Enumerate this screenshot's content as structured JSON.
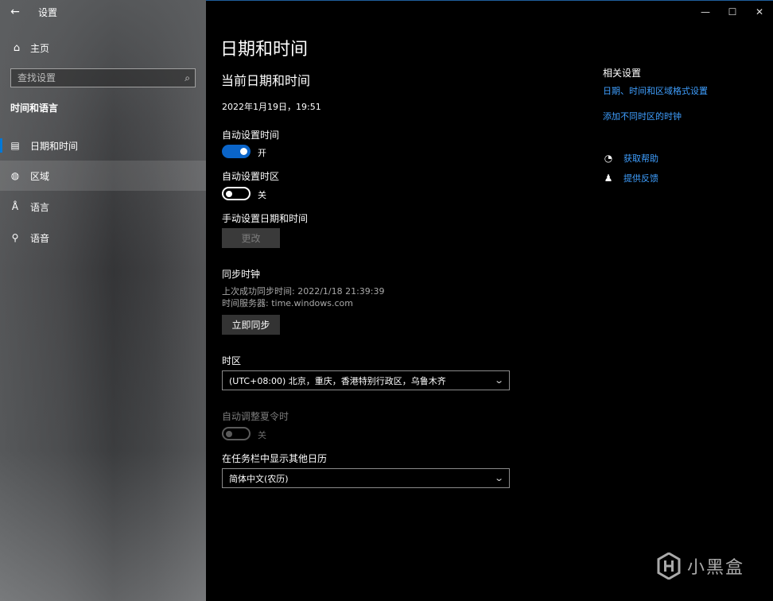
{
  "window": {
    "app_title": "设置",
    "back_icon": "←",
    "controls": {
      "minimize": "—",
      "maximize": "☐",
      "close": "✕"
    }
  },
  "sidebar": {
    "home_label": "主页",
    "search_placeholder": "查找设置",
    "section_title": "时间和语言",
    "items": [
      {
        "label": "日期和时间",
        "icon": "calendar-clock-icon"
      },
      {
        "label": "区域",
        "icon": "globe-icon"
      },
      {
        "label": "语言",
        "icon": "language-icon"
      },
      {
        "label": "语音",
        "icon": "microphone-icon"
      }
    ]
  },
  "main": {
    "title": "日期和时间",
    "subtitle": "当前日期和时间",
    "current_datetime": "2022年1月19日，19:51",
    "auto_time": {
      "label": "自动设置时间",
      "state": "开"
    },
    "auto_timezone": {
      "label": "自动设置时区",
      "state": "关"
    },
    "manual": {
      "label": "手动设置日期和时间",
      "button": "更改"
    },
    "sync": {
      "label": "同步时钟",
      "last_sync": "上次成功同步时间: 2022/1/18 21:39:39",
      "server": "时间服务器: time.windows.com",
      "button": "立即同步"
    },
    "timezone": {
      "label": "时区",
      "value": "(UTC+08:00) 北京，重庆，香港特别行政区，乌鲁木齐"
    },
    "dst": {
      "label": "自动调整夏令时",
      "state": "关"
    },
    "calendar": {
      "label": "在任务栏中显示其他日历",
      "value": "简体中文(农历)"
    }
  },
  "related": {
    "title": "相关设置",
    "links": [
      "日期、时间和区域格式设置",
      "添加不同时区的时钟"
    ],
    "help": "获取帮助",
    "feedback": "提供反馈"
  },
  "watermark": {
    "text": "小黑盒"
  },
  "colors": {
    "accent": "#0078d7",
    "link": "#3f9fff",
    "toggle_on": "#0a64c8"
  }
}
